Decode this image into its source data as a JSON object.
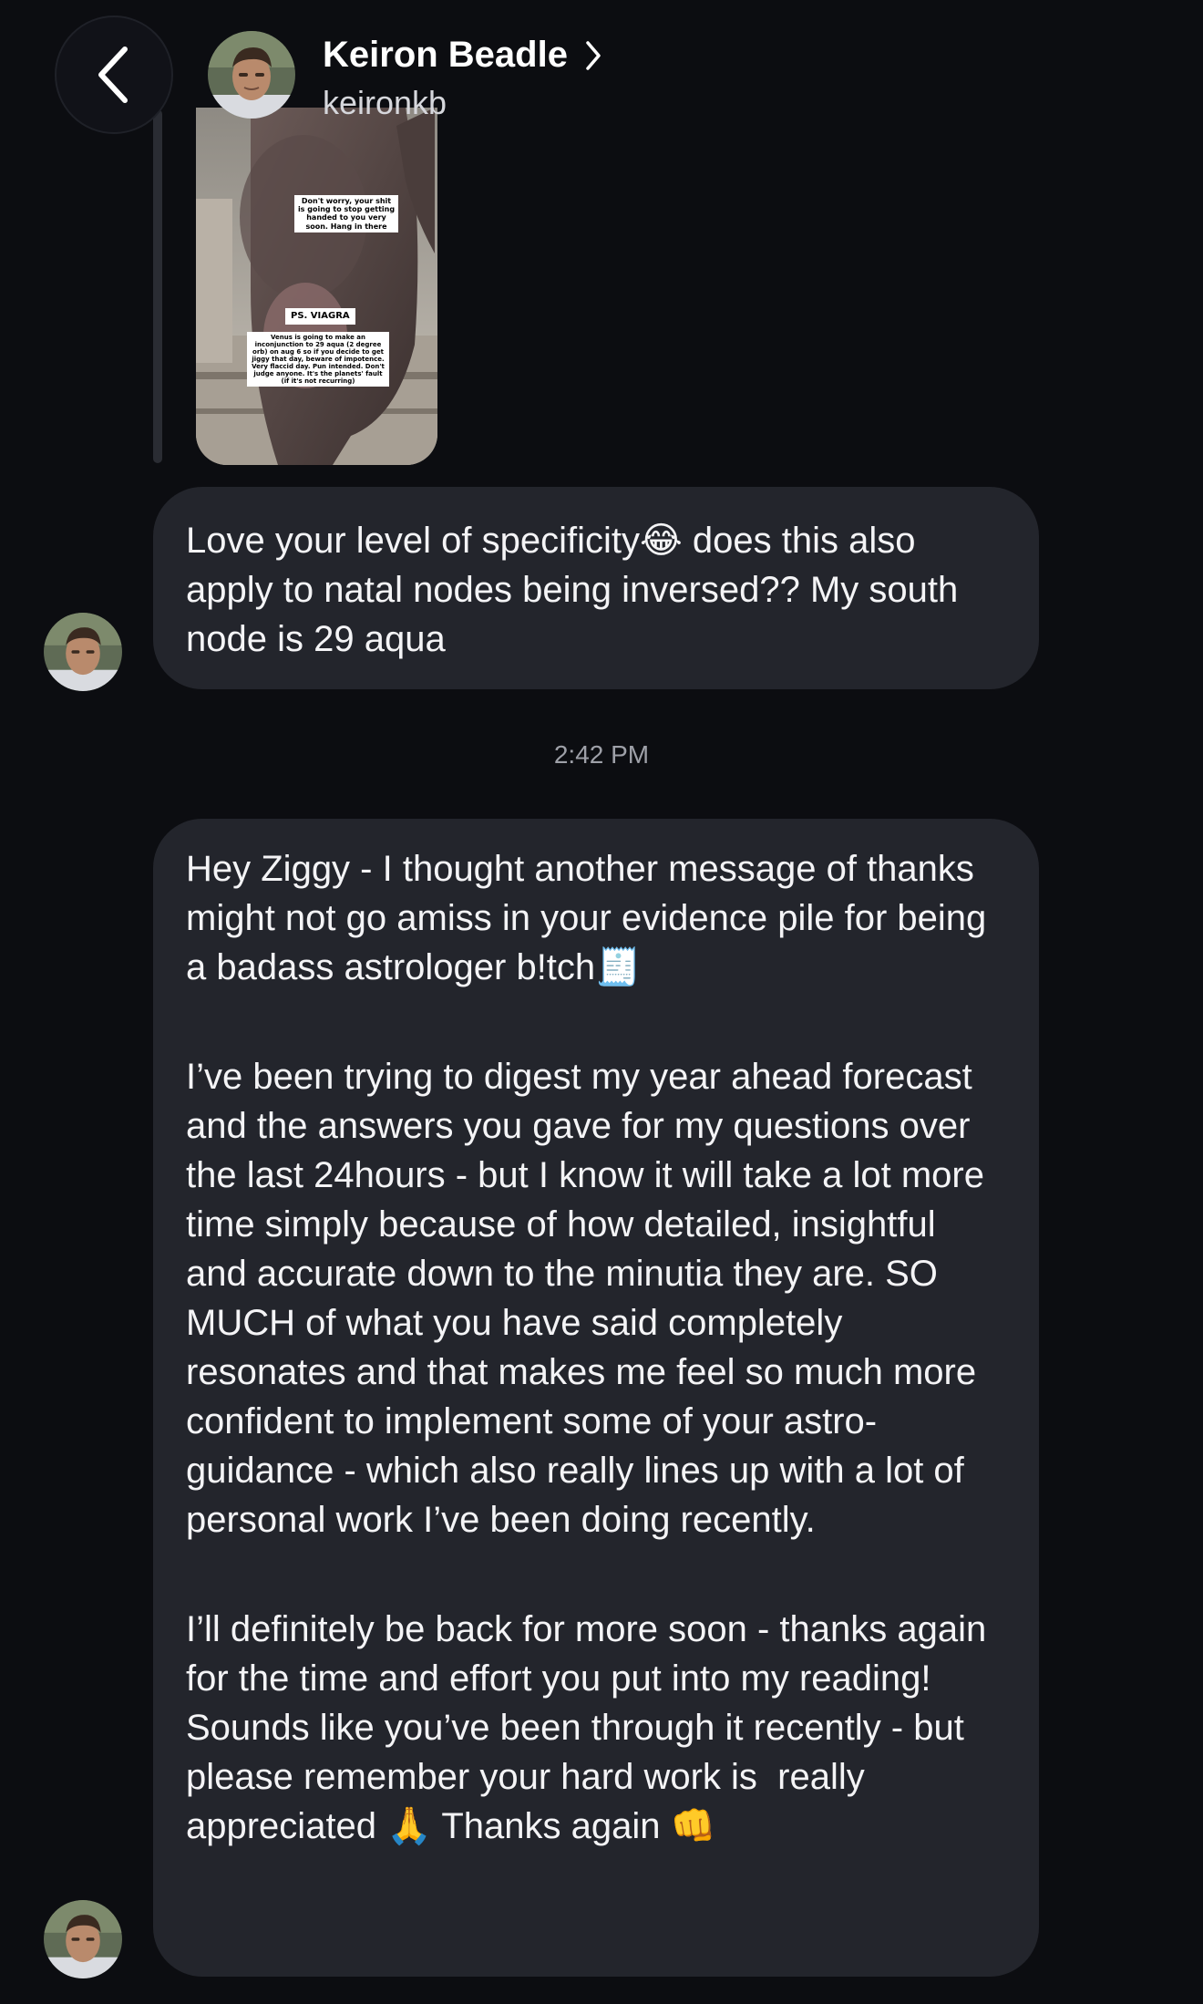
{
  "header": {
    "contact_name": "Keiron Beadle",
    "username": "keironkb"
  },
  "shared_image": {
    "caption_top": "Don't worry, your shit is going to stop getting handed to you very soon. Hang in there",
    "caption_mid": "PS. VIAGRA",
    "caption_bottom": "Venus is going to make an inconjunction to 29 aqua (2 degree orb) on aug 6 so if you decide to get jiggy that day, beware of impotence. Very flaccid day. Pun intended. Don't judge anyone. It's the planets' fault (if it's not recurring)"
  },
  "messages": [
    {
      "text": "Love your level of specificity😂 does this also apply to natal nodes being inversed?? My south node is 29 aqua"
    },
    {
      "paragraphs": [
        "Hey Ziggy - I thought another message of thanks might not go amiss in your evidence pile for being a badass astrologer b!tch🧾",
        "I’ve been trying to digest my year ahead forecast and the answers you gave for my questions over the last 24hours - but I know it will take a lot more time simply because of how detailed, insightful and accurate down to the minutia they are. SO MUCH of what you have said completely resonates and that makes me feel so much more confident to implement some of your astro-guidance - which also really lines up with a lot of personal work I’ve been doing recently.",
        "I’ll definitely be back for more soon - thanks again for the time and effort you put into my reading! Sounds like you’ve been through it recently - but please remember your hard work is  really appreciated 🙏 Thanks again 👊"
      ]
    }
  ],
  "timestamp": "2:42 PM",
  "icons": {
    "back": "chevron-left-icon",
    "profile_link": "chevron-right-icon"
  },
  "colors": {
    "background": "#0c0d11",
    "bubble": "#23252c",
    "text": "#f4f4f6",
    "timestamp": "#9ea0a8"
  }
}
